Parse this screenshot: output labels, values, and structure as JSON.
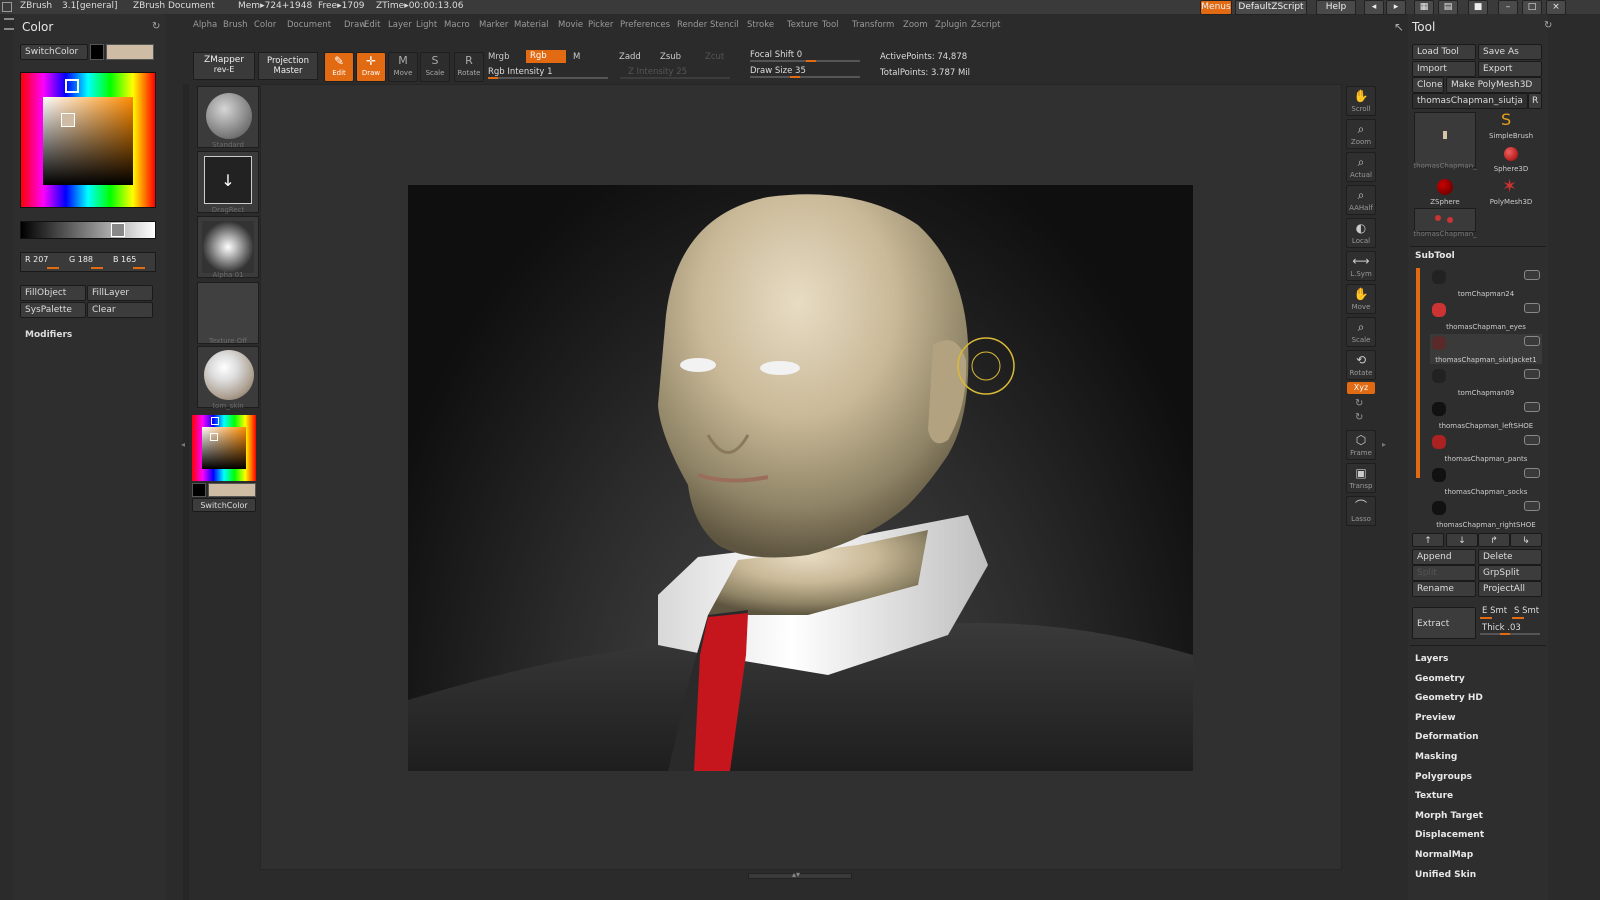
{
  "titlebar": {
    "app": "ZBrush",
    "version": "3.1[general]",
    "doc": "ZBrush Document",
    "mem": "Mem▸724+1948",
    "free": "Free▸1709",
    "ztime": "ZTime▸00:00:13.06",
    "menus_btn": "Menus",
    "script_btn": "DefaultZScript",
    "help_btn": "Help"
  },
  "menubar": [
    "Alpha",
    "Brush",
    "Color",
    "Document",
    "Draw",
    "Edit",
    "Layer",
    "Light",
    "Macro",
    "Marker",
    "Material",
    "Movie",
    "Picker",
    "Preferences",
    "Render",
    "Stencil",
    "Stroke",
    "Texture",
    "Tool",
    "Transform",
    "Zoom",
    "Zplugin",
    "Zscript"
  ],
  "color_panel": {
    "title": "Color",
    "switch_color": "SwitchColor",
    "r": "R 207",
    "g": "G 188",
    "b": "B 165",
    "fill_object": "FillObject",
    "fill_layer": "FillLayer",
    "sys_palette": "SysPalette",
    "clear": "Clear",
    "modifiers": "Modifiers",
    "primary_color": "#cfbca5"
  },
  "topshelf": {
    "zmapper": "ZMapper",
    "zmapper_sub": "rev-E",
    "projection": "Projection",
    "projection_sub": "Master",
    "edit": "Edit",
    "draw": "Draw",
    "move": "Move",
    "scale": "Scale",
    "rotate": "Rotate",
    "mrgb": "Mrgb",
    "rgb": "Rgb",
    "m": "M",
    "rgb_intensity": "Rgb Intensity 1",
    "zadd": "Zadd",
    "zsub": "Zsub",
    "zcut": "Zcut",
    "z_intensity": "Z Intensity 25",
    "focal_shift": "Focal Shift 0",
    "draw_size": "Draw Size 35",
    "active_points": "ActivePoints: 74,878",
    "total_points": "TotalPoints: 3.787 Mil"
  },
  "left_shelf": {
    "standard": "Standard",
    "dragrect": "DragRect",
    "alpha": "Alpha 01",
    "texture": "Texture Off",
    "material": "tom_skin",
    "switch_color": "SwitchColor"
  },
  "right_shelf": [
    "Scroll",
    "Zoom",
    "Actual",
    "AAHalf",
    "Local",
    "L.Sym",
    "Move",
    "Scale",
    "Rotate",
    "Frame",
    "Transp",
    "Lasso"
  ],
  "xyz": "Xyz",
  "tool_panel": {
    "title": "Tool",
    "load_tool": "Load Tool",
    "save_as": "Save As",
    "import": "Import",
    "export": "Export",
    "clone": "Clone",
    "make_polymesh": "Make PolyMesh3D",
    "current_tool": "thomasChapman_siutja",
    "r": "R",
    "tools": [
      {
        "label": "thomasChapman_"
      },
      {
        "label": "SimpleBrush"
      },
      {
        "label": "Sphere3D"
      },
      {
        "label": "ZSphere"
      },
      {
        "label": "PolyMesh3D"
      },
      {
        "label": "thomasChapman_"
      }
    ],
    "subtool_title": "SubTool",
    "subtools": [
      "tomChapman24",
      "thomasChapman_eyes",
      "thomasChapman_siutjacket1",
      "tomChapman09",
      "thomasChapman_leftSHOE",
      "thomasChapman_pants",
      "thomasChapman_socks",
      "thomasChapman_rightSHOE"
    ],
    "append": "Append",
    "delete": "Delete",
    "split": "Split",
    "grpsplit": "GrpSplit",
    "rename": "Rename",
    "projectall": "ProjectAll",
    "extract": "Extract",
    "e_smt": "E Smt",
    "s_smt": "S Smt",
    "thick": "Thick .03",
    "menu": [
      "Layers",
      "Geometry",
      "Geometry HD",
      "Preview",
      "Deformation",
      "Masking",
      "Polygroups",
      "Texture",
      "Morph Target",
      "Displacement",
      "NormalMap",
      "Unified Skin"
    ]
  }
}
